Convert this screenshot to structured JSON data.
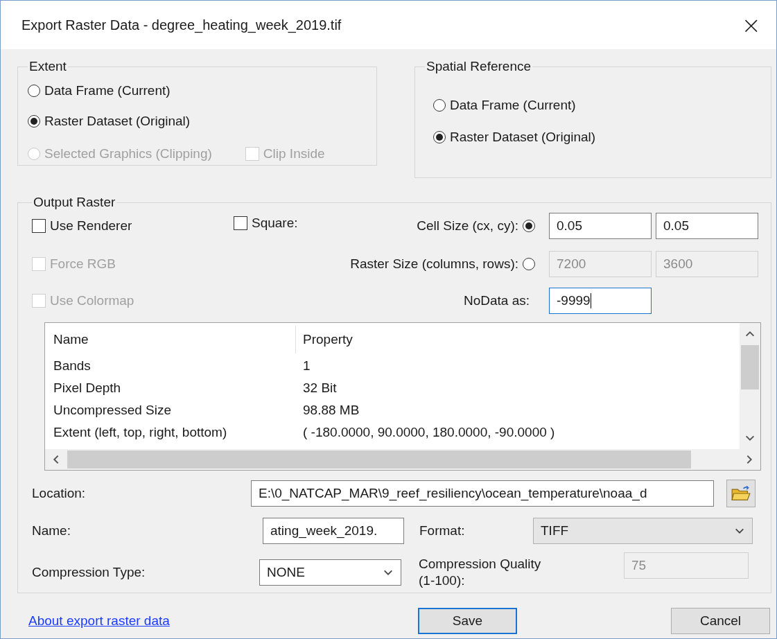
{
  "window": {
    "title": "Export Raster Data - degree_heating_week_2019.tif",
    "close": "×"
  },
  "extent": {
    "label": "Extent",
    "options": [
      {
        "label": "Data Frame (Current)",
        "selected": false,
        "disabled": false
      },
      {
        "label": "Raster Dataset (Original)",
        "selected": true,
        "disabled": false
      },
      {
        "label": "Selected Graphics (Clipping)",
        "selected": false,
        "disabled": true
      }
    ],
    "clip_inside": {
      "label": "Clip Inside",
      "checked": false,
      "disabled": true
    }
  },
  "spatial_reference": {
    "label": "Spatial Reference",
    "options": [
      {
        "label": "Data Frame (Current)",
        "selected": false,
        "disabled": false
      },
      {
        "label": "Raster Dataset (Original)",
        "selected": true,
        "disabled": false
      }
    ]
  },
  "output_raster": {
    "label": "Output Raster",
    "checkboxes": [
      {
        "label": "Use Renderer",
        "checked": false,
        "disabled": false
      },
      {
        "label": "Force RGB",
        "checked": false,
        "disabled": true
      },
      {
        "label": "Use Colormap",
        "checked": false,
        "disabled": true
      }
    ],
    "square": {
      "label": "Square:",
      "checked": false,
      "disabled": false
    },
    "size_options": [
      {
        "label": "Cell Size (cx, cy):",
        "selected": true,
        "values": [
          "0.05",
          "0.05"
        ],
        "disabled": false
      },
      {
        "label": "Raster Size (columns, rows):",
        "selected": false,
        "values": [
          "7200",
          "3600"
        ],
        "disabled": true
      }
    ],
    "nodata": {
      "label": "NoData as:",
      "value": "-9999"
    },
    "table": {
      "columns": [
        "Name",
        "Property"
      ],
      "rows": [
        [
          "Bands",
          "1"
        ],
        [
          "Pixel Depth",
          "32 Bit"
        ],
        [
          "Uncompressed Size",
          "98.88 MB"
        ],
        [
          "Extent (left, top, right, bottom)",
          "( -180.0000, 90.0000, 180.0000, -90.0000 )"
        ]
      ]
    },
    "location": {
      "label": "Location:",
      "value": "E:\\0_NATCAP_MAR\\9_reef_resiliency\\ocean_temperature\\noaa_d"
    },
    "name": {
      "label": "Name:",
      "value": "ating_week_2019."
    },
    "format": {
      "label": "Format:",
      "value": "TIFF"
    },
    "compression_type": {
      "label": "Compression Type:",
      "value": "NONE"
    },
    "compression_quality": {
      "label": "Compression Quality (1-100):",
      "value": "75",
      "disabled": true
    }
  },
  "link": "About export raster data",
  "buttons": [
    {
      "label": "Save",
      "default": true
    },
    {
      "label": "Cancel",
      "default": false
    }
  ]
}
